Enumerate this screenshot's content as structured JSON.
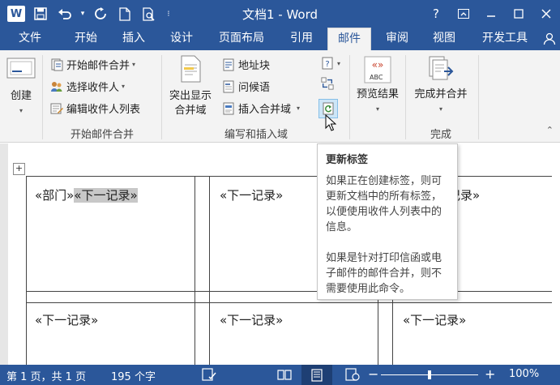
{
  "titlebar": {
    "title": "文档1 - Word",
    "app_icon": "W",
    "help": "?"
  },
  "tabs": [
    {
      "label": "文件",
      "active": false
    },
    {
      "label": "开始",
      "active": false
    },
    {
      "label": "插入",
      "active": false
    },
    {
      "label": "设计",
      "active": false
    },
    {
      "label": "页面布局",
      "active": false
    },
    {
      "label": "引用",
      "active": false
    },
    {
      "label": "邮件",
      "active": true
    },
    {
      "label": "审阅",
      "active": false
    },
    {
      "label": "视图",
      "active": false
    },
    {
      "label": "开发工具",
      "active": false
    }
  ],
  "ribbon": {
    "create": {
      "label": "创建",
      "icon": "envelope-icon"
    },
    "start_group": {
      "label": "开始邮件合并",
      "start_merge": "开始邮件合并",
      "select_recipients": "选择收件人",
      "edit_recipients": "编辑收件人列表"
    },
    "write_group": {
      "label": "编写和插入域",
      "highlight_fields_line1": "突出显示",
      "highlight_fields_line2": "合并域",
      "address_block": "地址块",
      "greeting_line": "问候语",
      "insert_merge_field": "插入合并域"
    },
    "preview_group": {
      "preview_results": "预览结果",
      "abc_badge": "ABC"
    },
    "finish_group": {
      "label": "完成",
      "finish_merge": "完成并合并"
    }
  },
  "document": {
    "cells": {
      "r1c1_field": "«部门»",
      "r1c1_next": "«下一记录»",
      "r1c2": "«下一记录»",
      "r1c3": "记录»",
      "r2c1": "«下一记录»",
      "r2c2": "«下一记录»",
      "r2c3": "«下一记录»"
    },
    "anchor": "+"
  },
  "tooltip": {
    "title": "更新标签",
    "para1": "如果正在创建标签，则可更新文档中的所有标签，以便使用收件人列表中的信息。",
    "para2": "如果是针对打印信函或电子邮件的邮件合并，则不需要使用此命令。"
  },
  "statusbar": {
    "page": "第 1 页，共 1 页",
    "words": "195 个字",
    "zoom_minus": "−",
    "zoom_plus": "+",
    "zoom": "100%",
    "zoom_level_percent": 100
  },
  "colors": {
    "brand": "#2b579a",
    "ribbon_bg": "#f3f3f3",
    "highlight": "#c8c8c8"
  }
}
